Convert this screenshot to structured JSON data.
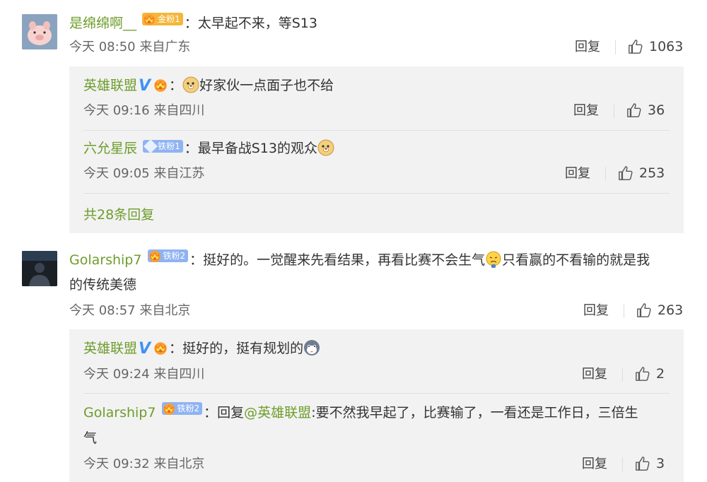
{
  "comments": [
    {
      "user": "是绵绵啊__",
      "badge": "金粉1",
      "text": "太早起不来，等S13",
      "time": "今天 08:50 来自广东",
      "reply_label": "回复",
      "likes": "1063",
      "replies": [
        {
          "user": "英雄联盟",
          "verified": "V",
          "text": "好家伙一点面子也不给",
          "time": "今天 09:16 来自四川",
          "reply_label": "回复",
          "likes": "36"
        },
        {
          "user": "六允星辰",
          "badge": "铁粉1",
          "text": "最早备战S13的观众",
          "time": "今天 09:05 来自江苏",
          "reply_label": "回复",
          "likes": "253"
        }
      ],
      "more": "共28条回复"
    },
    {
      "user": "Golarship7",
      "badge": "铁粉2",
      "text_a": "挺好的。一觉醒来先看结果，再看比赛不会生气",
      "text_b": "只看赢的不看输的就是我",
      "text_c": "的传统美德",
      "time": "今天 08:57 来自北京",
      "reply_label": "回复",
      "likes": "263",
      "replies": [
        {
          "user": "英雄联盟",
          "verified": "V",
          "text": "挺好的，挺有规划的",
          "time": "今天 09:24 来自四川",
          "reply_label": "回复",
          "likes": "2"
        },
        {
          "user": "Golarship7",
          "badge": "铁粉2",
          "reply_prefix": "回复",
          "mention": "@英雄联盟",
          "text_a": ":要不然我早起了，比赛输了，一看还是工作日，三倍生",
          "text_b": "气",
          "time": "今天 09:32 来自北京",
          "reply_label": "回复",
          "likes": "3"
        }
      ]
    }
  ],
  "colors": {
    "username": "#6e9d2c",
    "verified": "#3f92f3",
    "reply_bg": "#f2f2f2"
  }
}
